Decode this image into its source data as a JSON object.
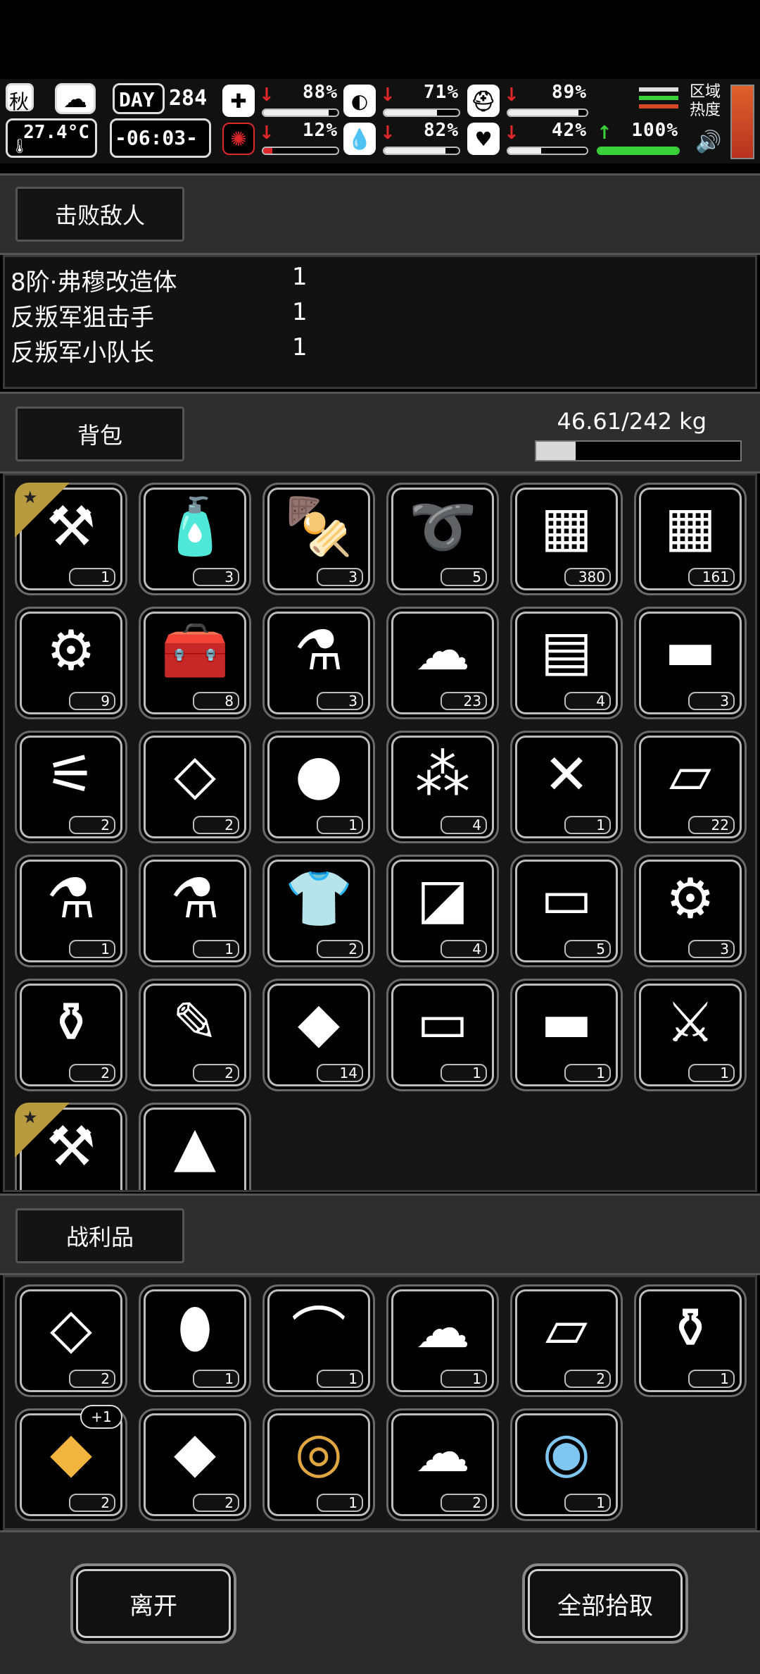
{
  "hud": {
    "season": "秋",
    "temperature": "27.4°C",
    "day_label": "DAY",
    "day_number": "284",
    "time": "-06:03-",
    "stats": [
      {
        "name": "health",
        "icon": "medkit-icon",
        "glyph": "✚",
        "trend": "down",
        "value": "88%",
        "level": 0.88
      },
      {
        "name": "hunger",
        "icon": "stomach-icon",
        "glyph": "◐",
        "trend": "down",
        "value": "71%",
        "level": 0.71
      },
      {
        "name": "armor",
        "icon": "helmet-icon",
        "glyph": "⛑",
        "trend": "down",
        "value": "89%",
        "level": 0.89
      },
      {
        "name": "sanity",
        "icon": "brain-icon",
        "glyph": "✺",
        "trend": "down",
        "value": "12%",
        "level": 0.12
      },
      {
        "name": "thirst",
        "icon": "water-drop-icon",
        "glyph": "💧",
        "trend": "down",
        "value": "82%",
        "level": 0.82
      },
      {
        "name": "mood",
        "icon": "heart-icon",
        "glyph": "♥",
        "trend": "down",
        "value": "42%",
        "level": 0.42
      },
      {
        "name": "stamina",
        "icon": "boot-icon",
        "glyph": "▲",
        "trend": "up",
        "value": "100%",
        "level": 1.0
      }
    ],
    "region_heat_label": "区域\n热度"
  },
  "colors": {
    "trend_down": "#e0282a",
    "trend_up": "#3ad13a",
    "star": "#b89b3e",
    "heat_bar": "#d6482a"
  },
  "defeated": {
    "title": "击败敌人",
    "enemies": [
      {
        "name": "8阶·弗穆改造体",
        "count": "1"
      },
      {
        "name": "反叛军狙击手",
        "count": "1"
      },
      {
        "name": "反叛军小队长",
        "count": "1"
      }
    ]
  },
  "backpack": {
    "title": "背包",
    "weight": "46.61/242 kg",
    "weight_fraction": 0.1926,
    "items": [
      {
        "name": "shovel",
        "glyph": "⚒",
        "count": "1",
        "starred": true
      },
      {
        "name": "water-bottle",
        "glyph": "🧴",
        "count": "3"
      },
      {
        "name": "meat-skewer",
        "glyph": "🍢",
        "count": "3"
      },
      {
        "name": "rope",
        "glyph": "➰",
        "count": "5"
      },
      {
        "name": "crate-iii",
        "glyph": "▦",
        "count": "380"
      },
      {
        "name": "crate-iv",
        "glyph": "▦",
        "count": "161"
      },
      {
        "name": "toolbox-bag",
        "glyph": "⚙",
        "count": "9"
      },
      {
        "name": "tool-case",
        "glyph": "🧰",
        "count": "8"
      },
      {
        "name": "test-tube-iii",
        "glyph": "⚗",
        "count": "3"
      },
      {
        "name": "cloth",
        "glyph": "☁",
        "count": "23"
      },
      {
        "name": "wood-planks",
        "glyph": "▤",
        "count": "4"
      },
      {
        "name": "stone-slabs",
        "glyph": "▬",
        "count": "3"
      },
      {
        "name": "scrap-parts",
        "glyph": "⚟",
        "count": "2"
      },
      {
        "name": "metal-sheets",
        "glyph": "◇",
        "count": "2"
      },
      {
        "name": "cotton-balls",
        "glyph": "●",
        "count": "1"
      },
      {
        "name": "gravel",
        "glyph": "⁂",
        "count": "4"
      },
      {
        "name": "screws",
        "glyph": "✕",
        "count": "1"
      },
      {
        "name": "paper-sheets",
        "glyph": "▱",
        "count": "22"
      },
      {
        "name": "test-tube-i",
        "glyph": "⚗",
        "count": "1"
      },
      {
        "name": "test-tube-iv",
        "glyph": "⚗",
        "count": "1"
      },
      {
        "name": "torn-shirt",
        "glyph": "👕",
        "count": "2"
      },
      {
        "name": "yellow-cloth",
        "glyph": "◪",
        "count": "4"
      },
      {
        "name": "white-cloth",
        "glyph": "▭",
        "count": "5"
      },
      {
        "name": "mech-part",
        "glyph": "⚙",
        "count": "3"
      },
      {
        "name": "beaker",
        "glyph": "⚱",
        "count": "2"
      },
      {
        "name": "soldering-iron",
        "glyph": "✎",
        "count": "2"
      },
      {
        "name": "ore-chunk",
        "glyph": "◆",
        "count": "14"
      },
      {
        "name": "towel",
        "glyph": "▭",
        "count": "1"
      },
      {
        "name": "cash-bundle",
        "glyph": "▬",
        "count": "1"
      },
      {
        "name": "spiked-club",
        "glyph": "⚔",
        "count": "1"
      },
      {
        "name": "caliper-tool",
        "glyph": "⚒",
        "count": "",
        "starred": true
      },
      {
        "name": "bottle",
        "glyph": "▲",
        "count": ""
      }
    ]
  },
  "loot": {
    "title": "战利品",
    "items": [
      {
        "name": "leather-sheet",
        "glyph": "◇",
        "count": "2"
      },
      {
        "name": "bullet",
        "glyph": "⬮",
        "count": "1"
      },
      {
        "name": "cloth-roll",
        "glyph": "⌒",
        "count": "1"
      },
      {
        "name": "fabric-scrap",
        "glyph": "☁",
        "count": "1"
      },
      {
        "name": "paper-sheets",
        "glyph": "▱",
        "count": "2"
      },
      {
        "name": "beaker",
        "glyph": "⚱",
        "count": "1"
      },
      {
        "name": "gold-ore",
        "glyph": "◆",
        "count": "2",
        "badge": "+1",
        "tint": "#f2b640"
      },
      {
        "name": "ore-chunk",
        "glyph": "◆",
        "count": "2"
      },
      {
        "name": "gold-roll",
        "glyph": "◎",
        "count": "1",
        "tint": "#e0a640"
      },
      {
        "name": "cloth",
        "glyph": "☁",
        "count": "2"
      },
      {
        "name": "eye-arm-part",
        "glyph": "◉",
        "count": "1",
        "tint": "#7fc7f0"
      }
    ]
  },
  "actions": {
    "leave": "离开",
    "take_all": "全部拾取"
  }
}
